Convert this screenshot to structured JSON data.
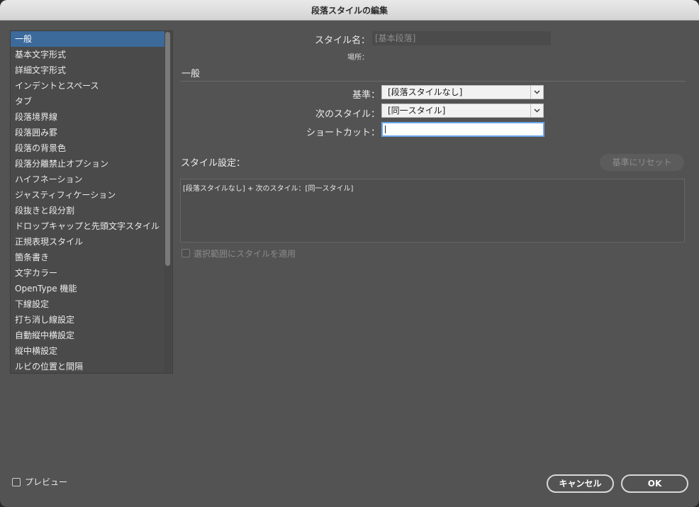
{
  "dialog": {
    "title": "段落スタイルの編集"
  },
  "sidebar": {
    "items": [
      {
        "label": "一般",
        "selected": true
      },
      {
        "label": "基本文字形式"
      },
      {
        "label": "詳細文字形式"
      },
      {
        "label": "インデントとスペース"
      },
      {
        "label": "タブ"
      },
      {
        "label": "段落境界線"
      },
      {
        "label": "段落囲み罫"
      },
      {
        "label": "段落の背景色"
      },
      {
        "label": "段落分離禁止オプション"
      },
      {
        "label": "ハイフネーション"
      },
      {
        "label": "ジャスティフィケーション"
      },
      {
        "label": "段抜きと段分割"
      },
      {
        "label": "ドロップキャップと先頭文字スタイル"
      },
      {
        "label": "正規表現スタイル"
      },
      {
        "label": "箇条書き"
      },
      {
        "label": "文字カラー"
      },
      {
        "label": "OpenType 機能"
      },
      {
        "label": "下線設定"
      },
      {
        "label": "打ち消し線設定"
      },
      {
        "label": "自動縦中横設定"
      },
      {
        "label": "縦中横設定"
      },
      {
        "label": "ルビの位置と間隔"
      }
    ]
  },
  "main": {
    "style_name_label": "スタイル名：",
    "style_name_value": "[基本段落]",
    "location_label": "場所：",
    "section_title": "一般",
    "based_on_label": "基準：",
    "based_on_value": "[段落スタイルなし]",
    "next_style_label": "次のスタイル：",
    "next_style_value": "[同一スタイル]",
    "shortcut_label": "ショートカット：",
    "shortcut_value": "",
    "style_settings_label": "スタイル設定：",
    "reset_button": "基準にリセット",
    "style_settings_text": "[段落スタイルなし] + 次のスタイル：[同一スタイル]",
    "apply_to_selection_label": "選択範囲にスタイルを適用"
  },
  "footer": {
    "preview_label": "プレビュー",
    "cancel_button": "キャンセル",
    "ok_button": "OK"
  },
  "colors": {
    "dialog_bg": "#535353",
    "selection": "#3b6a9b",
    "focus_ring": "#6aa6e8"
  }
}
